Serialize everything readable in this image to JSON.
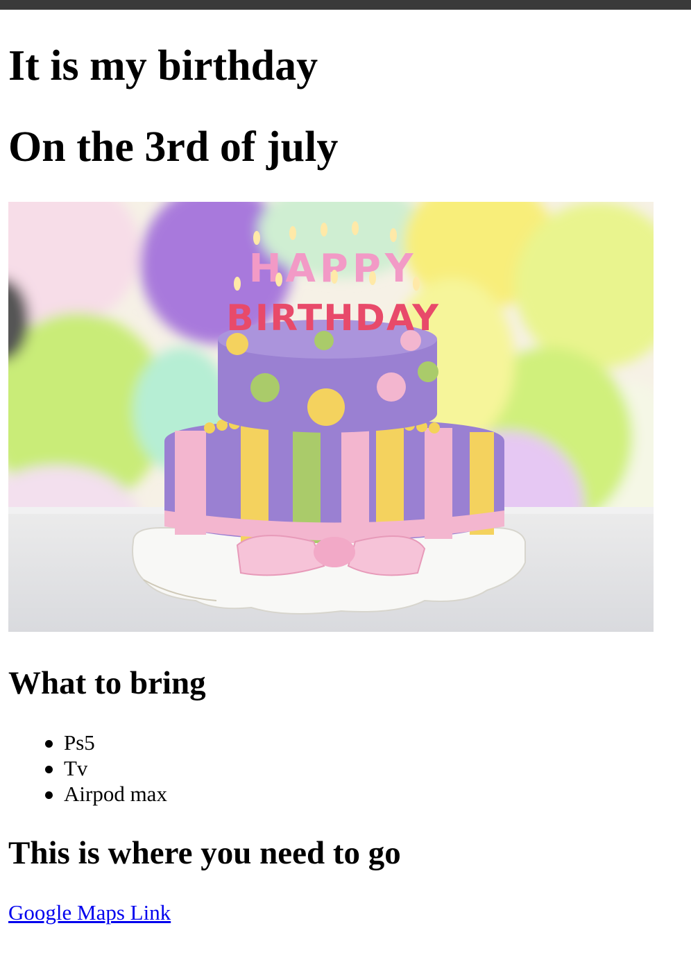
{
  "page": {
    "heading_main": "It is my birthday",
    "heading_date": "On the 3rd of july",
    "image": {
      "icon": "birthday-cake-photo",
      "candle_text_top": "HAPPY",
      "candle_text_bottom": "BIRTHDAY"
    },
    "bring_heading": "What to bring",
    "bring_items": [
      "Ps5",
      "Tv",
      "Airpod max"
    ],
    "location_heading": "This is where you need to go",
    "maps_link": "Google Maps Link"
  },
  "colors": {
    "topbar": "#3a3a3a",
    "link": "#0000ee",
    "cake_purple": "#9a80d2",
    "cake_pink": "#f3b6cf",
    "cake_yellow": "#f4d25e",
    "cake_green": "#aacb6a"
  }
}
